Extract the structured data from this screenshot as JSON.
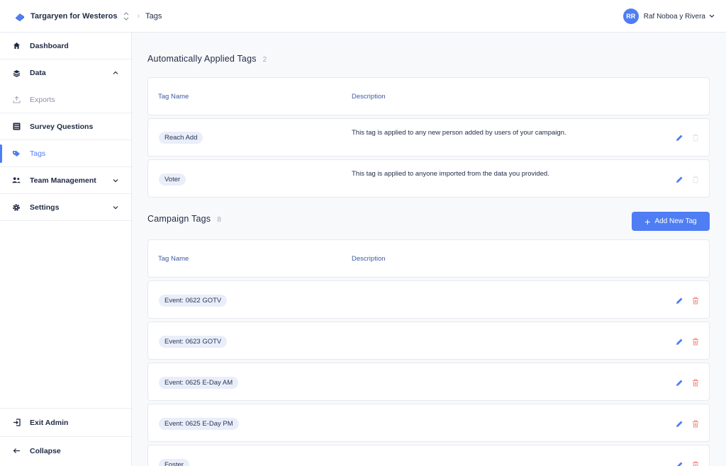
{
  "header": {
    "org_name": "Targaryen for Westeros",
    "breadcrumb_page": "Tags",
    "user_initials": "RR",
    "user_name": "Raf Noboa y Rivera"
  },
  "sidebar": {
    "items": [
      {
        "label": "Dashboard",
        "icon": "home-icon"
      },
      {
        "label": "Data",
        "icon": "layers-icon"
      },
      {
        "label": "Exports",
        "icon": "upload-icon"
      },
      {
        "label": "Survey Questions",
        "icon": "list-icon"
      },
      {
        "label": "Tags",
        "icon": "tag-icon"
      },
      {
        "label": "Team Management",
        "icon": "users-icon"
      },
      {
        "label": "Settings",
        "icon": "gear-icon"
      }
    ],
    "exit_label": "Exit Admin",
    "collapse_label": "Collapse"
  },
  "auto_tags": {
    "title": "Automatically Applied Tags",
    "count": "2",
    "col_name": "Tag Name",
    "col_desc": "Description",
    "rows": [
      {
        "name": "Reach Add",
        "description": "This tag is applied to any new person added by users of your campaign."
      },
      {
        "name": "Voter",
        "description": "This tag is applied to anyone imported from the data you provided."
      }
    ]
  },
  "campaign_tags": {
    "title": "Campaign Tags",
    "count": "8",
    "add_label": "Add New Tag",
    "col_name": "Tag Name",
    "col_desc": "Description",
    "rows": [
      {
        "name": "Event: 0622 GOTV"
      },
      {
        "name": "Event: 0623 GOTV"
      },
      {
        "name": "Event: 0625 E-Day AM"
      },
      {
        "name": "Event: 0625 E-Day PM"
      },
      {
        "name": "Foster"
      }
    ]
  },
  "colors": {
    "accent": "#4f7df3",
    "delete": "#f28b82",
    "pill_bg": "#e9eef9"
  }
}
